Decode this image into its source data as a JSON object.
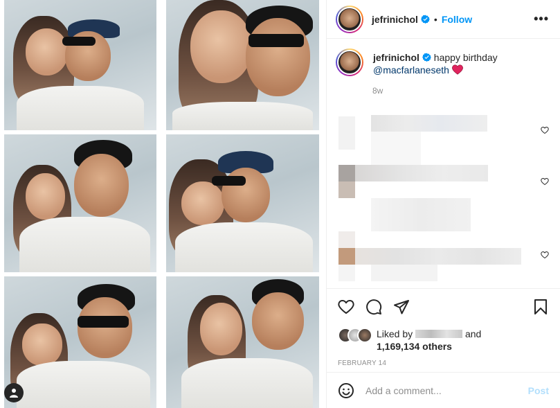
{
  "post": {
    "username": "jefrinichol",
    "follow_label": "Follow",
    "dot": "•",
    "more_label": "•••"
  },
  "caption": {
    "username": "jefrinichol",
    "text": "happy birthday",
    "mention": "@macfarlaneseth",
    "time": "8w"
  },
  "likes": {
    "prefix": "Liked by",
    "suffix": "and",
    "count": "1,169,134 others",
    "date": "FEBRUARY 14"
  },
  "comment_box": {
    "placeholder": "Add a comment...",
    "post_label": "Post"
  },
  "colors": {
    "accent": "#0095f6",
    "verified": "#0095f6",
    "heart": "#e0245e",
    "muted": "#8e8e8e",
    "post_disabled": "#b2dffc"
  },
  "icons": {
    "like": "heart-outline-icon",
    "comment": "speech-bubble-icon",
    "share": "paper-plane-icon",
    "save": "bookmark-icon",
    "emoji": "smiley-icon",
    "more": "ellipsis-icon"
  }
}
